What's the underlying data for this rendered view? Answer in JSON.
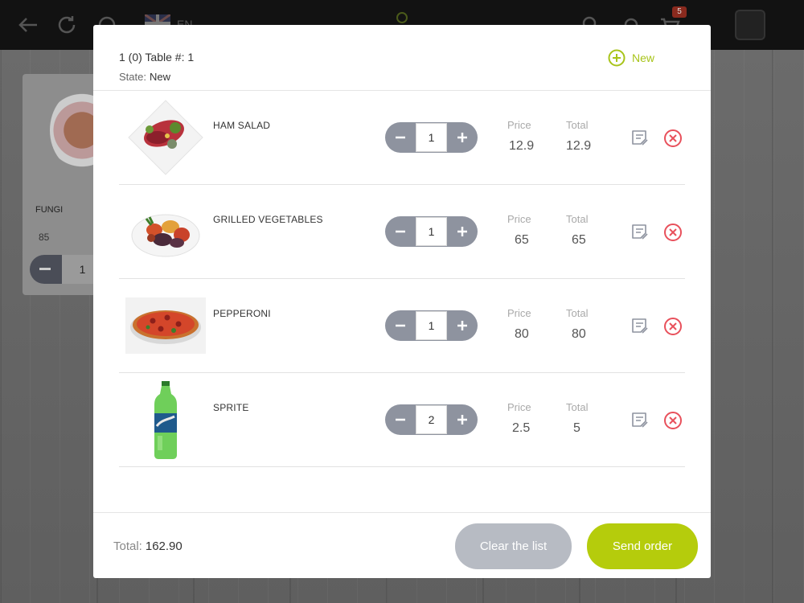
{
  "topbar": {
    "language": "EN",
    "cart_count": "5"
  },
  "background_card": {
    "name": "FUNGI",
    "price": "85",
    "qty": "1"
  },
  "modal": {
    "title": "1 (0) Table #: 1",
    "state_label": "State:",
    "state_value": "New",
    "new_label": "New",
    "price_label": "Price",
    "total_label": "Total",
    "items": [
      {
        "name": "HAM SALAD",
        "qty": "1",
        "price": "12.9",
        "total": "12.9"
      },
      {
        "name": "GRILLED VEGETABLES",
        "qty": "1",
        "price": "65",
        "total": "65"
      },
      {
        "name": "PEPPERONI",
        "qty": "1",
        "price": "80",
        "total": "80"
      },
      {
        "name": "SPRITE",
        "qty": "2",
        "price": "2.5",
        "total": "5"
      }
    ],
    "footer": {
      "total_label": "Total:",
      "total_value": "162.90",
      "clear_label": "Clear the list",
      "send_label": "Send order"
    }
  },
  "colors": {
    "accent": "#b5cc0c",
    "remove": "#e8505b",
    "stepper": "#8e939f"
  }
}
